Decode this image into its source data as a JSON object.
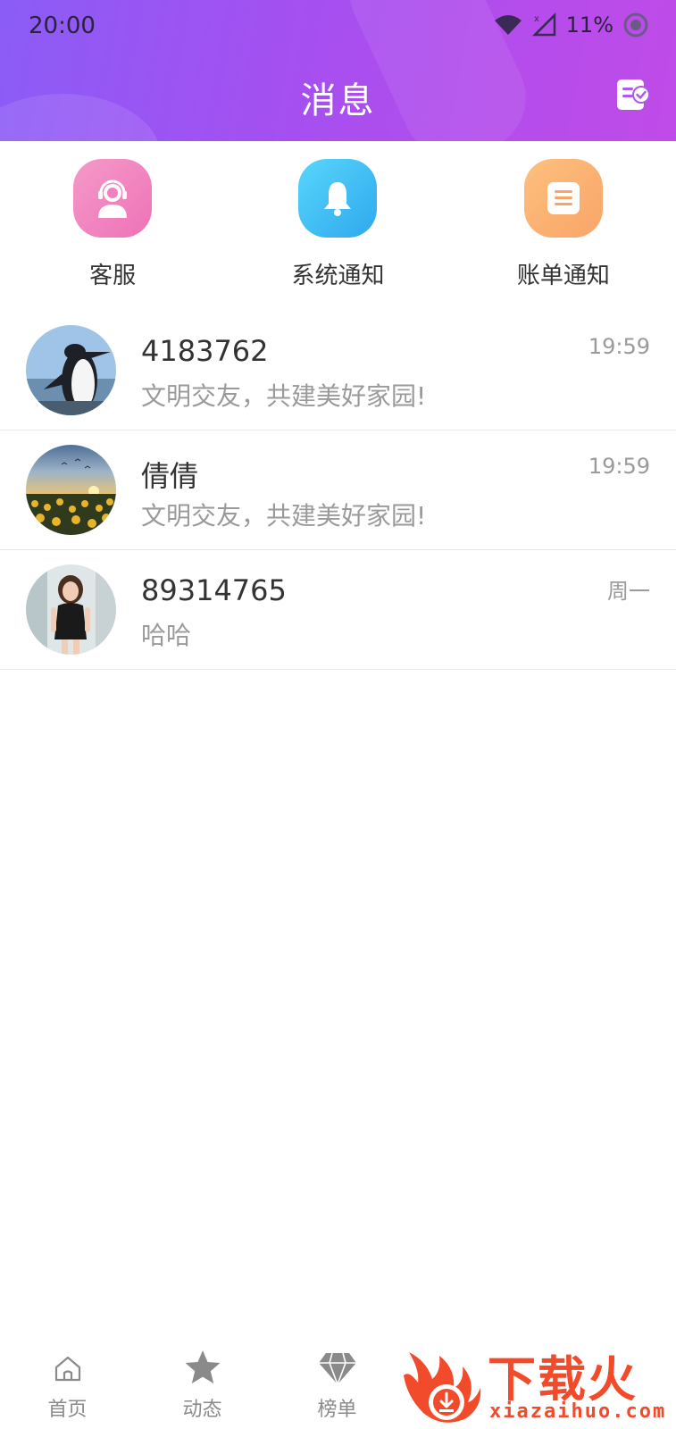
{
  "status_bar": {
    "time": "20:00",
    "battery": "11%",
    "icons": [
      "wifi-icon",
      "no-sim-icon",
      "battery-ring-icon"
    ]
  },
  "header": {
    "title": "消息",
    "action_icon": "contacts-check-icon",
    "gradient_colors": [
      "#8b5cf6",
      "#c04be8"
    ]
  },
  "quick_entries": [
    {
      "label": "客服",
      "icon": "customer-service-icon",
      "color": "#f080c0"
    },
    {
      "label": "系统通知",
      "icon": "bell-icon",
      "color": "#3ec0f4"
    },
    {
      "label": "账单通知",
      "icon": "bill-icon",
      "color": "#fbb070"
    }
  ],
  "messages": [
    {
      "name": "4183762",
      "preview": "文明交友，共建美好家园!",
      "time": "19:59",
      "avatar": "penguin-avatar"
    },
    {
      "name": "倩倩",
      "preview": "文明交友，共建美好家园!",
      "time": "19:59",
      "avatar": "sunflower-field-avatar"
    },
    {
      "name": "89314765",
      "preview": "哈哈",
      "time": "周一",
      "avatar": "woman-photo-avatar"
    }
  ],
  "tabbar": {
    "tabs": [
      {
        "label": "首页",
        "icon": "home-icon"
      },
      {
        "label": "动态",
        "icon": "star-icon"
      },
      {
        "label": "榜单",
        "icon": "diamond-icon"
      }
    ]
  },
  "watermark": {
    "text": "下载火",
    "url": "xiazaihuo.com",
    "color": "#f24b2c"
  }
}
